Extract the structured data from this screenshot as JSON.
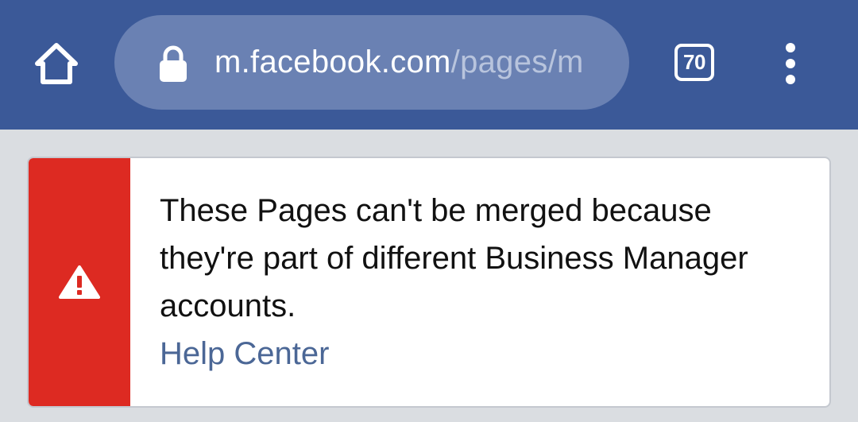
{
  "browser": {
    "url_host": "m.facebook.com",
    "url_path": "/pages/m",
    "tab_count": "70",
    "icons": {
      "home": "home-icon",
      "lock": "lock-icon",
      "menu": "more-vert-icon",
      "warning": "warning-icon"
    },
    "colors": {
      "toolbar": "#3b5998",
      "url_bar": "#6a81b3"
    }
  },
  "alert": {
    "message": "These Pages can't be merged because they're part of different Business Manager accounts.",
    "link_label": "Help Center",
    "colors": {
      "stripe": "#dd2a22",
      "link": "#4b6796"
    }
  }
}
